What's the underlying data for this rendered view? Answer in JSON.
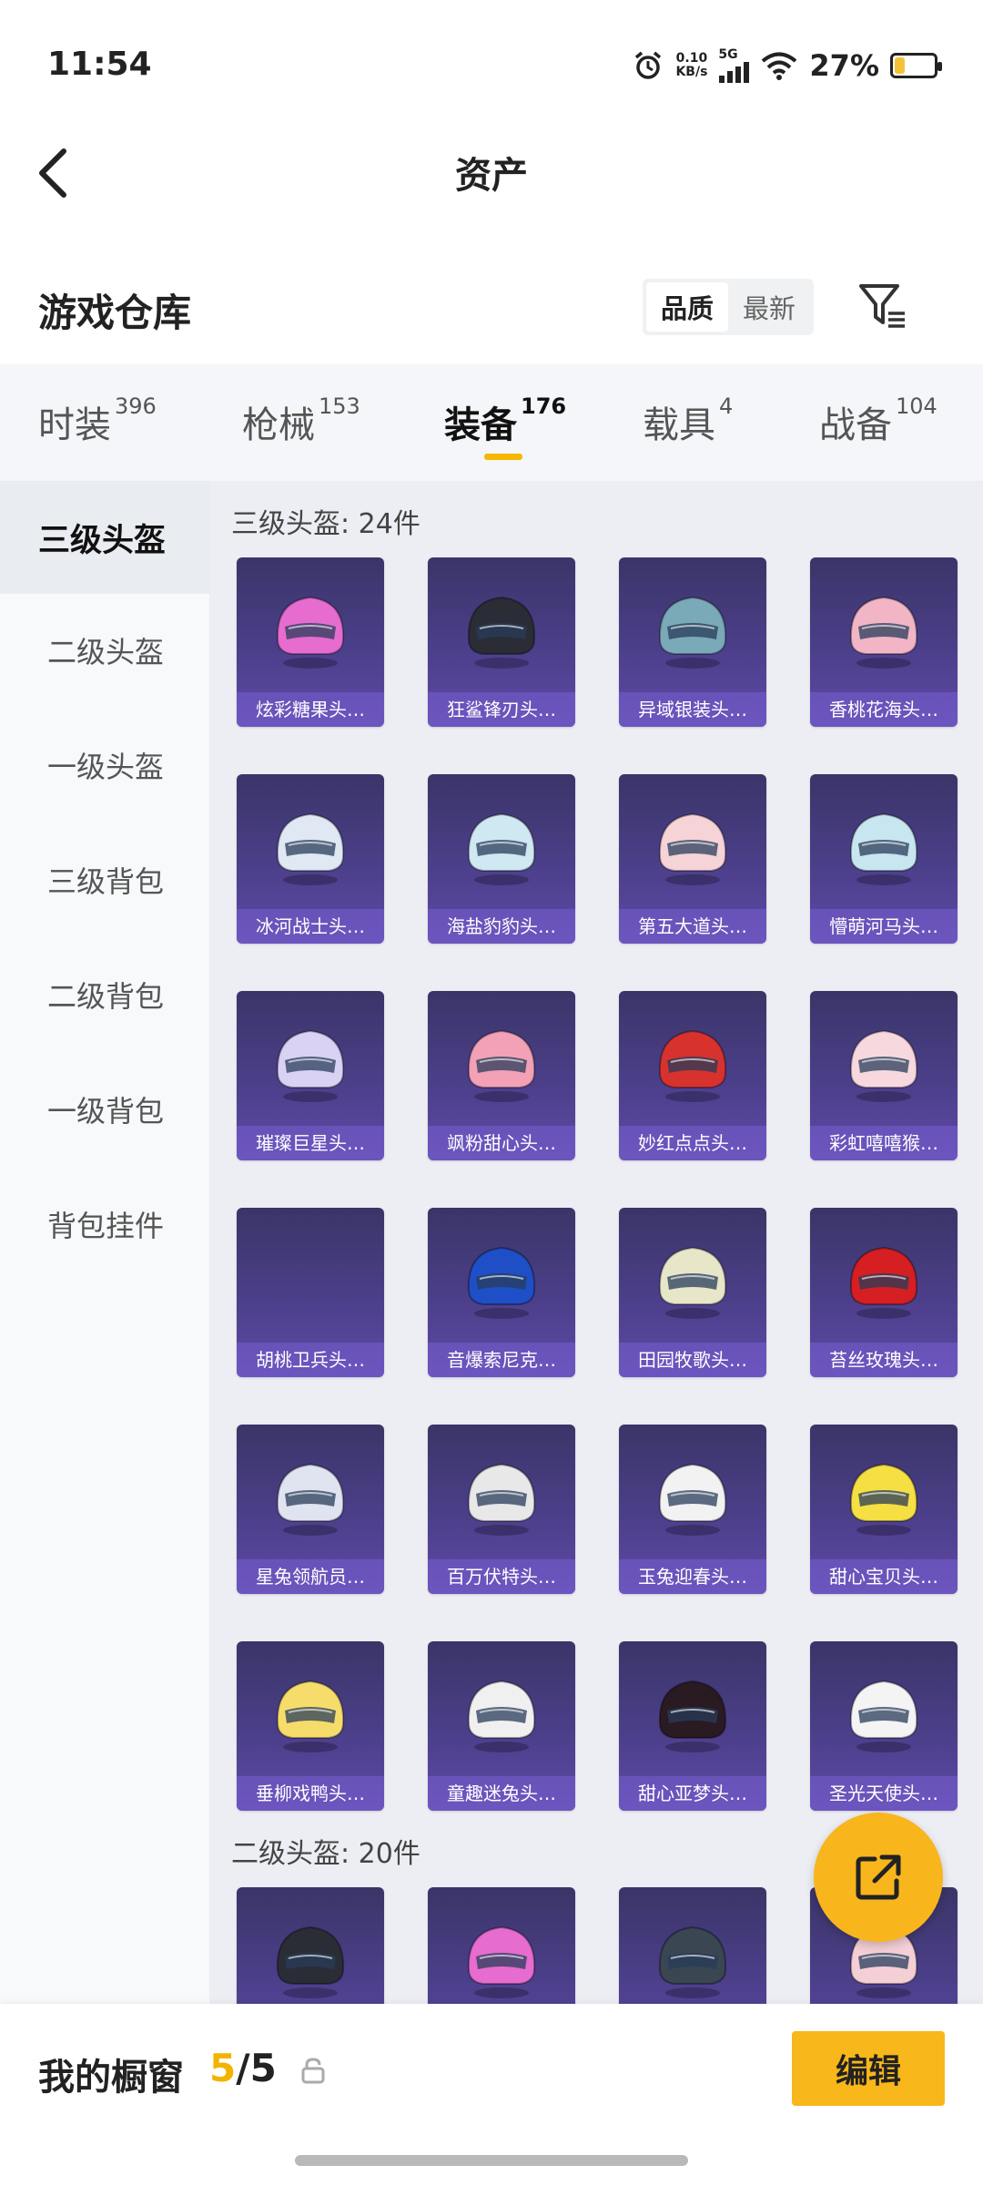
{
  "status_bar": {
    "time": "11:54",
    "net_speed_value": "0.10",
    "net_speed_unit": "KB/s",
    "network": "5G",
    "battery_percent": "27%",
    "battery_level": 0.27
  },
  "header": {
    "title": "资产"
  },
  "warehouse": {
    "title": "游戏仓库",
    "sort_options": [
      "品质",
      "最新"
    ],
    "active_sort": "品质"
  },
  "tabs": [
    {
      "label": "时装",
      "count": "396"
    },
    {
      "label": "枪械",
      "count": "153"
    },
    {
      "label": "装备",
      "count": "176"
    },
    {
      "label": "载具",
      "count": "4"
    },
    {
      "label": "战备",
      "count": "104"
    }
  ],
  "active_tab": "装备",
  "sidebar": {
    "items": [
      {
        "label": "三级头盔"
      },
      {
        "label": "二级头盔"
      },
      {
        "label": "一级头盔"
      },
      {
        "label": "三级背包"
      },
      {
        "label": "二级背包"
      },
      {
        "label": "一级背包"
      },
      {
        "label": "背包挂件"
      }
    ],
    "active": "三级头盔"
  },
  "sections": [
    {
      "title": "三级头盔: 24件",
      "items": [
        {
          "name": "炫彩糖果头…",
          "color": "#e66ccf"
        },
        {
          "name": "狂鲨锋刃头…",
          "color": "#2b2d36"
        },
        {
          "name": "异域银装头…",
          "color": "#7aa9b8"
        },
        {
          "name": "香桃花海头…",
          "color": "#f1b5c6"
        },
        {
          "name": "冰河战士头…",
          "color": "#dfe8f3"
        },
        {
          "name": "海盐豹豹头…",
          "color": "#cfe8f2"
        },
        {
          "name": "第五大道头…",
          "color": "#f6d3d6"
        },
        {
          "name": "懵萌河马头…",
          "color": "#c8e6f0"
        },
        {
          "name": "璀璨巨星头…",
          "color": "#d9d2f5"
        },
        {
          "name": "飒粉甜心头…",
          "color": "#f2a1b6"
        },
        {
          "name": "妙红点点头…",
          "color": "#d8322f"
        },
        {
          "name": "彩虹嘻嘻猴…",
          "color": "#f7d8df"
        },
        {
          "name": "胡桃卫兵头…",
          "color": ""
        },
        {
          "name": "音爆索尼克…",
          "color": "#1f4fc7"
        },
        {
          "name": "田园牧歌头…",
          "color": "#e8e6c9"
        },
        {
          "name": "苔丝玫瑰头…",
          "color": "#d61f22"
        },
        {
          "name": "星兔领航员…",
          "color": "#dfe4f0"
        },
        {
          "name": "百万伏特头…",
          "color": "#e8e8e8"
        },
        {
          "name": "玉兔迎春头…",
          "color": "#f2f2f2"
        },
        {
          "name": "甜心宝贝头…",
          "color": "#f6df42"
        },
        {
          "name": "垂柳戏鸭头…",
          "color": "#f6dd6b"
        },
        {
          "name": "童趣迷兔头…",
          "color": "#f0f0f0"
        },
        {
          "name": "甜心亚梦头…",
          "color": "#2a1a22"
        },
        {
          "name": "圣光天使头…",
          "color": "#f4f4f4"
        }
      ]
    },
    {
      "title": "二级头盔: 20件",
      "items": [
        {
          "name": "",
          "color": "#2b2d36"
        },
        {
          "name": "",
          "color": "#e66ccf"
        },
        {
          "name": "",
          "color": "#3a4652"
        },
        {
          "name": "",
          "color": "#f4cfd6"
        }
      ]
    }
  ],
  "showcase": {
    "label": "我的橱窗",
    "current": "5",
    "total": "/5",
    "edit_label": "编辑"
  },
  "colors": {
    "accent": "#f5b700",
    "card_bg": "#4c3f8a"
  }
}
